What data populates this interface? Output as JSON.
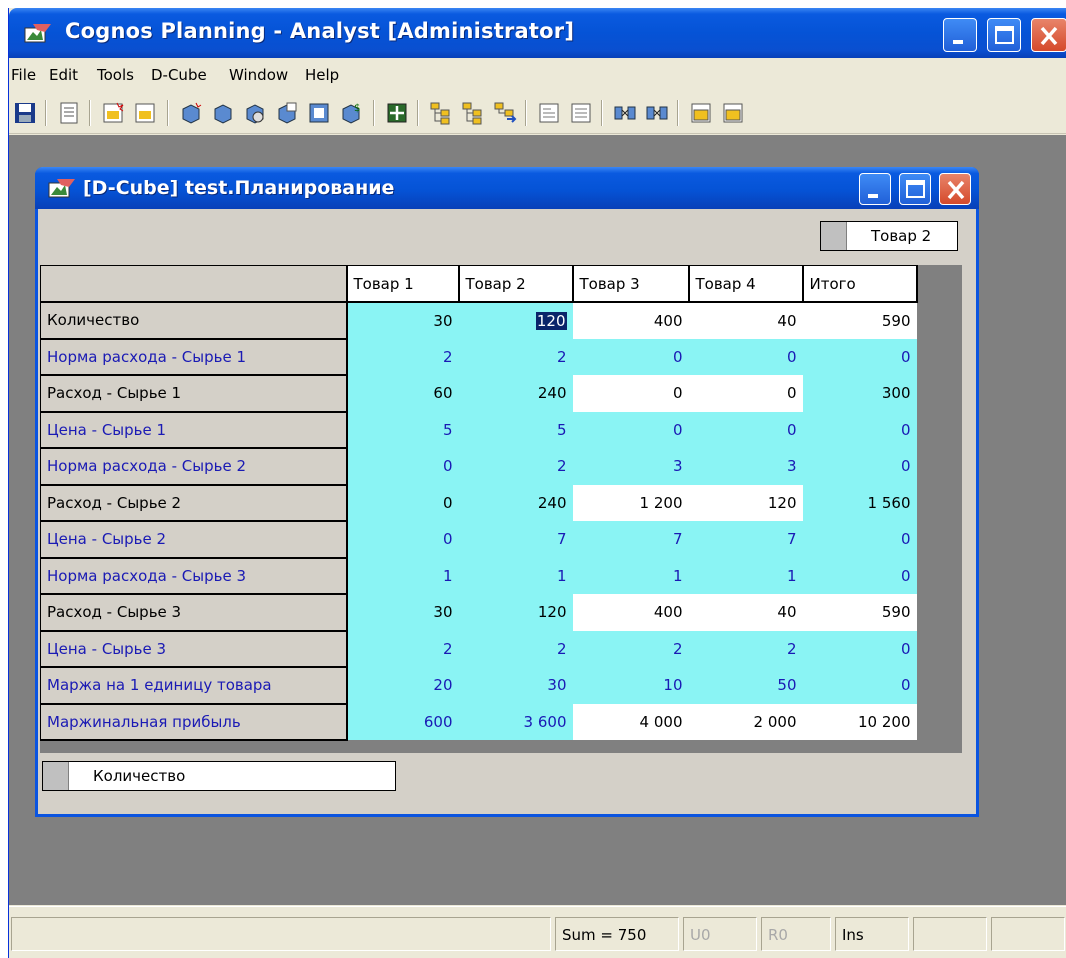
{
  "app": {
    "title": "Cognos Planning - Analyst [Administrator]"
  },
  "menu": [
    "File",
    "Edit",
    "Tools",
    "D-Cube",
    "Window",
    "Help"
  ],
  "toolbar_icons": [
    "save-icon",
    "list-icon",
    "new-dcube-icon",
    "open-dcube-icon",
    "cube-icon",
    "cube-open-icon",
    "cube-search-icon",
    "cube-new-icon",
    "cube-calc-icon",
    "cube-dollar-icon",
    "grid-icon",
    "tree-new-icon",
    "tree-open-icon",
    "tree-arrow-icon",
    "doc-new-icon",
    "doc-open-icon",
    "link-new-icon",
    "link-open-icon",
    "table-new-icon",
    "table-open-icon"
  ],
  "child": {
    "title": "[D-Cube] test.Планирование",
    "context_dim": "Товар 2",
    "row_dim": "Количество"
  },
  "grid": {
    "columns": [
      "Товар 1",
      "Товар 2",
      "Товар 3",
      "Товар 4",
      "Итого"
    ],
    "rows": [
      {
        "label": "Количество",
        "values": [
          "30",
          "120",
          "400",
          "40",
          "590"
        ]
      },
      {
        "label": "Норма расхода - Сырье 1",
        "values": [
          "2",
          "2",
          "0",
          "0",
          "0"
        ]
      },
      {
        "label": "Расход - Сырье 1",
        "values": [
          "60",
          "240",
          "0",
          "0",
          "300"
        ]
      },
      {
        "label": "Цена - Сырье 1",
        "values": [
          "5",
          "5",
          "0",
          "0",
          "0"
        ]
      },
      {
        "label": "Норма расхода - Сырье 2",
        "values": [
          "0",
          "2",
          "3",
          "3",
          "0"
        ]
      },
      {
        "label": "Расход - Сырье 2",
        "values": [
          "0",
          "240",
          "1 200",
          "120",
          "1 560"
        ]
      },
      {
        "label": "Цена - Сырье 2",
        "values": [
          "0",
          "7",
          "7",
          "7",
          "0"
        ]
      },
      {
        "label": "Норма расхода - Сырье 3",
        "values": [
          "1",
          "1",
          "1",
          "1",
          "0"
        ]
      },
      {
        "label": "Расход - Сырье 3",
        "values": [
          "30",
          "120",
          "400",
          "40",
          "590"
        ]
      },
      {
        "label": "Цена - Сырье 3",
        "values": [
          "2",
          "2",
          "2",
          "2",
          "0"
        ]
      },
      {
        "label": "Маржа на 1 единицу товара",
        "values": [
          "20",
          "30",
          "10",
          "50",
          "0"
        ]
      },
      {
        "label": "Маржинальная прибыль",
        "values": [
          "600",
          "3 600",
          "4 000",
          "2 000",
          "10 200"
        ]
      }
    ]
  },
  "status": {
    "sum": "Sum = 750",
    "u": "U0",
    "r": "R0",
    "mode": "Ins"
  },
  "colors": {
    "cyan_cell": "#8af4f4",
    "blue_text": "#1a1ab4",
    "xp_blue": "#0553d6"
  }
}
